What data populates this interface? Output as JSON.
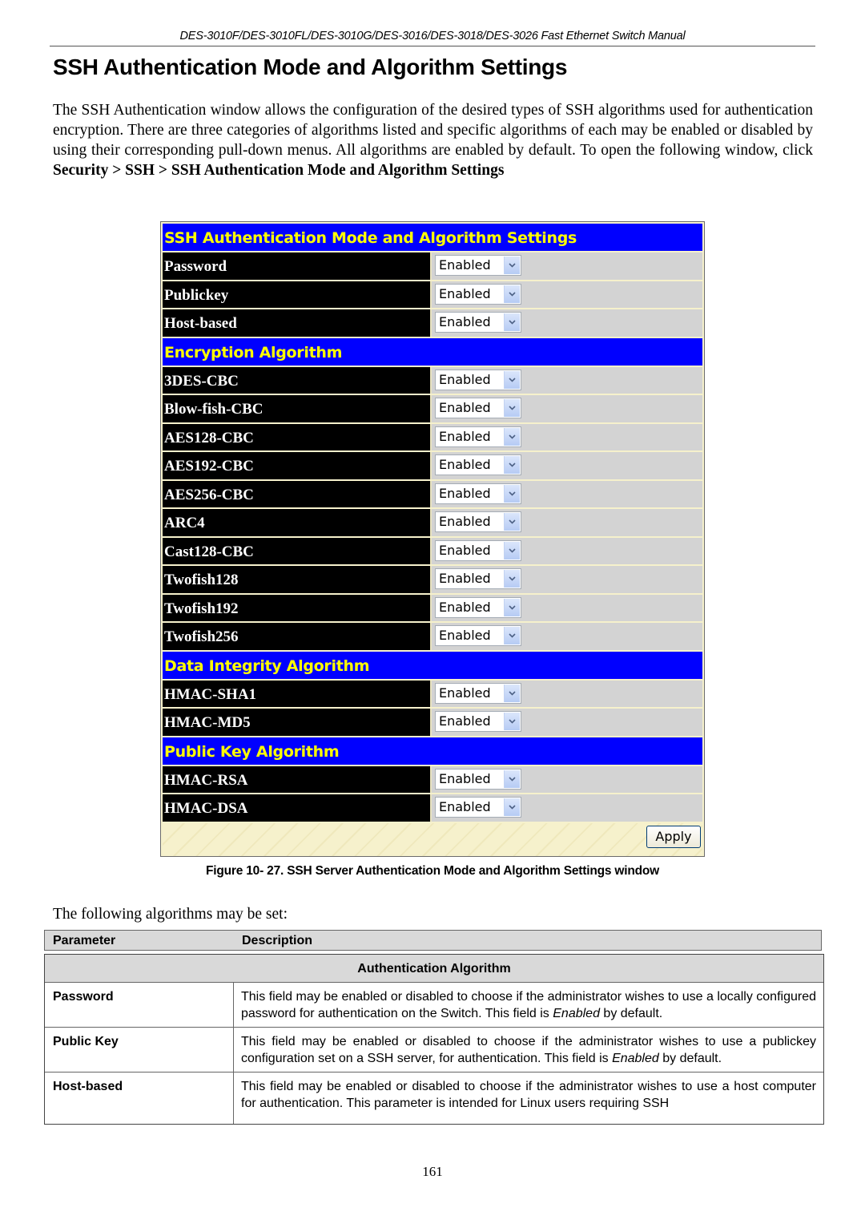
{
  "running_header": "DES-3010F/DES-3010FL/DES-3010G/DES-3016/DES-3018/DES-3026 Fast Ethernet Switch Manual",
  "page_title": "SSH Authentication Mode and Algorithm Settings",
  "intro": {
    "text": "The SSH Authentication window allows the configuration of the desired types of SSH algorithms used for authentication encryption. There are three categories of algorithms listed and specific algorithms of each may be enabled or disabled by using their corresponding pull-down menus. All algorithms are enabled by default. To open the following window, click ",
    "path": "Security > SSH > SSH Authentication Mode and Algorithm Settings"
  },
  "window": {
    "colors": {
      "header_bg": "#0000ff",
      "header_text": "#ffff00",
      "label_bg": "#000000",
      "value_bg": "#d3d3d3"
    },
    "sections": [
      {
        "title": "SSH Authentication Mode and Algorithm Settings",
        "rows": [
          {
            "label": "Password",
            "value": "Enabled"
          },
          {
            "label": "Publickey",
            "value": "Enabled"
          },
          {
            "label": "Host-based",
            "value": "Enabled"
          }
        ]
      },
      {
        "title": "Encryption Algorithm",
        "rows": [
          {
            "label": "3DES-CBC",
            "value": "Enabled"
          },
          {
            "label": "Blow-fish-CBC",
            "value": "Enabled"
          },
          {
            "label": "AES128-CBC",
            "value": "Enabled"
          },
          {
            "label": "AES192-CBC",
            "value": "Enabled"
          },
          {
            "label": "AES256-CBC",
            "value": "Enabled"
          },
          {
            "label": "ARC4",
            "value": "Enabled"
          },
          {
            "label": "Cast128-CBC",
            "value": "Enabled"
          },
          {
            "label": "Twofish128",
            "value": "Enabled"
          },
          {
            "label": "Twofish192",
            "value": "Enabled"
          },
          {
            "label": "Twofish256",
            "value": "Enabled"
          }
        ]
      },
      {
        "title": "Data Integrity Algorithm",
        "rows": [
          {
            "label": "HMAC-SHA1",
            "value": "Enabled"
          },
          {
            "label": "HMAC-MD5",
            "value": "Enabled"
          }
        ]
      },
      {
        "title": "Public Key Algorithm",
        "rows": [
          {
            "label": "HMAC-RSA",
            "value": "Enabled"
          },
          {
            "label": "HMAC-DSA",
            "value": "Enabled"
          }
        ]
      }
    ],
    "apply_label": "Apply",
    "dropdown_icon": "chevron-down-icon"
  },
  "figure_caption": "Figure 10- 27. SSH Server Authentication Mode and Algorithm Settings window",
  "lead_in": "The following algorithms may be set:",
  "param_table": {
    "headers": {
      "parameter": "Parameter",
      "description": "Description"
    },
    "section_title": "Authentication Algorithm",
    "rows": [
      {
        "name": "Password",
        "desc_before": "This field may be enabled or disabled to choose if the administrator wishes to use a locally configured password for authentication on the Switch. This field is ",
        "desc_em": "Enabled",
        "desc_after": " by default."
      },
      {
        "name": "Public Key",
        "desc_before": "This field may be enabled or disabled to choose if the administrator wishes to use a publickey configuration set on a SSH server, for authentication. This field is ",
        "desc_em": "Enabled",
        "desc_after": " by default."
      },
      {
        "name": "Host-based",
        "desc_before": "This field may be enabled or disabled to choose if the administrator wishes to use a host computer for authentication. This parameter is intended for Linux users requiring SSH",
        "desc_em": "",
        "desc_after": ""
      }
    ]
  },
  "page_number": "161"
}
